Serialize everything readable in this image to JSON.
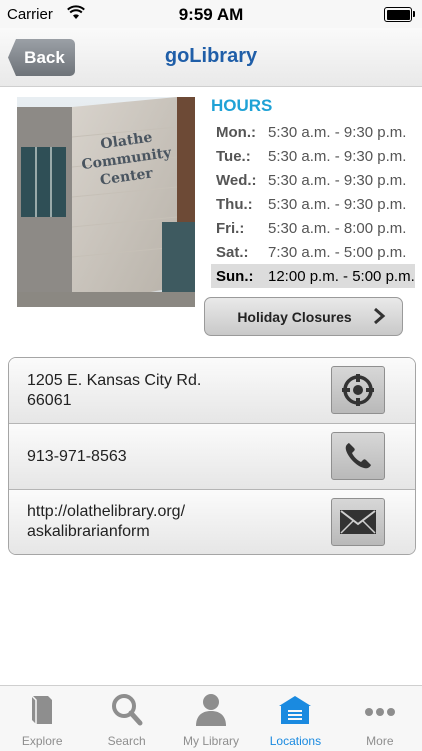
{
  "status": {
    "carrier": "Carrier",
    "time": "9:59 AM"
  },
  "nav": {
    "back_label": "Back",
    "title": "goLibrary"
  },
  "photo": {
    "alt": "Olathe Community Center"
  },
  "hours": {
    "title": "HOURS",
    "rows": [
      {
        "day": "Mon.:",
        "time": "5:30 a.m. - 9:30 p.m."
      },
      {
        "day": "Tue.:",
        "time": "5:30 a.m. - 9:30 p.m."
      },
      {
        "day": "Wed.:",
        "time": "5:30 a.m. - 9:30 p.m."
      },
      {
        "day": "Thu.:",
        "time": "5:30 a.m. - 9:30 p.m."
      },
      {
        "day": "Fri.:",
        "time": "5:30 a.m. - 8:00 p.m."
      },
      {
        "day": "Sat.:",
        "time": "7:30 a.m. - 5:00 p.m."
      },
      {
        "day": "Sun.:",
        "time": "12:00 p.m. - 5:00 p.m."
      }
    ]
  },
  "holiday": {
    "label": "Holiday Closures"
  },
  "contact": {
    "address_line1": "1205 E. Kansas City Rd.",
    "address_line2": "66061",
    "phone": "913-971-8563",
    "url_line1": "http://olathelibrary.org/",
    "url_line2": "askalibrarianform"
  },
  "tabs": [
    {
      "label": "Explore",
      "icon": "book-icon"
    },
    {
      "label": "Search",
      "icon": "search-icon"
    },
    {
      "label": "My Library",
      "icon": "person-icon"
    },
    {
      "label": "Locations",
      "icon": "building-icon"
    },
    {
      "label": "More",
      "icon": "more-icon"
    }
  ],
  "colors": {
    "accent": "#1a8ae0",
    "hours_title": "#1fa2d6",
    "nav_title": "#1f5ea8"
  }
}
